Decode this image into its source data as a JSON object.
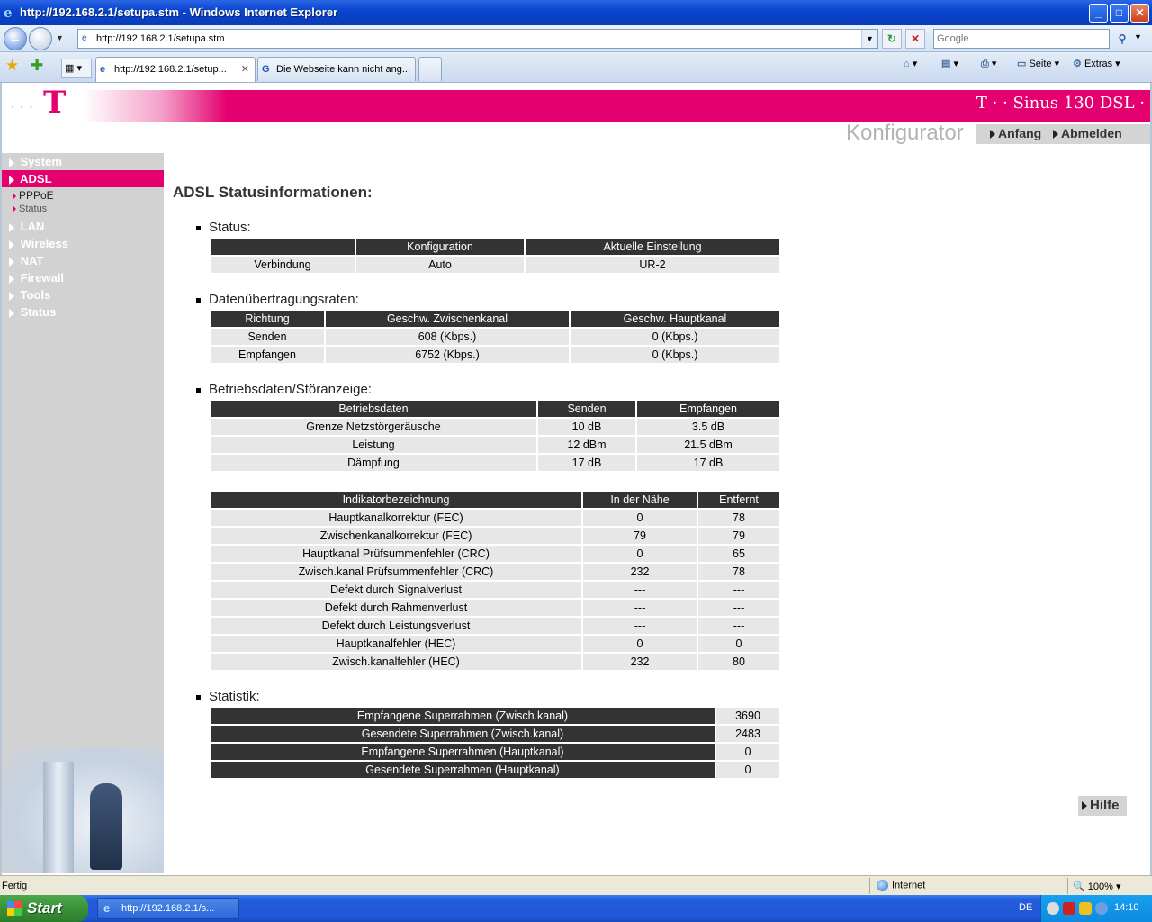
{
  "window": {
    "title": "http://192.168.2.1/setupa.stm - Windows Internet Explorer",
    "minimize": "_",
    "maximize": "□",
    "close": "✕"
  },
  "navbar": {
    "back": "←",
    "forward": "→",
    "address": "http://192.168.2.1/setupa.stm",
    "refresh": "↻",
    "stop": "✕",
    "search_placeholder": "Google"
  },
  "tabs": [
    {
      "label": "http://192.168.2.1/setup..."
    },
    {
      "label": "Die Webseite kann nicht ang..."
    }
  ],
  "tools": {
    "page": "Seite",
    "extras": "Extras"
  },
  "brand": {
    "logo": "T",
    "product": "T · · Sinus 130 DSL ·",
    "konfigurator": "Konfigurator"
  },
  "topnav": {
    "anfang": "Anfang",
    "abmelden": "Abmelden"
  },
  "sidebar": {
    "items": [
      "System",
      "ADSL",
      "LAN",
      "Wireless",
      "NAT",
      "Firewall",
      "Tools",
      "Status"
    ],
    "active": "ADSL",
    "subitems": [
      "PPPoE",
      "Status"
    ]
  },
  "main": {
    "title": "ADSL Statusinformationen:",
    "status": {
      "heading": "Status:",
      "headers": [
        "",
        "Konfiguration",
        "Aktuelle Einstellung"
      ],
      "rows": [
        [
          "Verbindung",
          "Auto",
          "UR-2"
        ]
      ]
    },
    "rates": {
      "heading": "Datenübertragungsraten:",
      "headers": [
        "Richtung",
        "Geschw. Zwischenkanal",
        "Geschw. Hauptkanal"
      ],
      "rows": [
        [
          "Senden",
          "608 (Kbps.)",
          "0 (Kbps.)"
        ],
        [
          "Empfangen",
          "6752 (Kbps.)",
          "0 (Kbps.)"
        ]
      ]
    },
    "operating": {
      "heading": "Betriebsdaten/Störanzeige:",
      "headers": [
        "Betriebsdaten",
        "Senden",
        "Empfangen"
      ],
      "rows": [
        [
          "Grenze Netzstörgeräusche",
          "10 dB",
          "3.5 dB"
        ],
        [
          "Leistung",
          "12 dBm",
          "21.5 dBm"
        ],
        [
          "Dämpfung",
          "17 dB",
          "17 dB"
        ]
      ]
    },
    "indicators": {
      "headers": [
        "Indikatorbezeichnung",
        "In der Nähe",
        "Entfernt"
      ],
      "rows": [
        [
          "Hauptkanalkorrektur (FEC)",
          "0",
          "78"
        ],
        [
          "Zwischenkanalkorrektur (FEC)",
          "79",
          "79"
        ],
        [
          "Hauptkanal Prüfsummenfehler (CRC)",
          "0",
          "65"
        ],
        [
          "Zwisch.kanal Prüfsummenfehler (CRC)",
          "232",
          "78"
        ],
        [
          "Defekt durch Signalverlust",
          "---",
          "---"
        ],
        [
          "Defekt durch Rahmenverlust",
          "---",
          "---"
        ],
        [
          "Defekt durch Leistungsverlust",
          "---",
          "---"
        ],
        [
          "Hauptkanalfehler (HEC)",
          "0",
          "0"
        ],
        [
          "Zwisch.kanalfehler (HEC)",
          "232",
          "80"
        ]
      ]
    },
    "statistics": {
      "heading": "Statistik:",
      "rows": [
        [
          "Empfangene Superrahmen (Zwisch.kanal)",
          "3690"
        ],
        [
          "Gesendete Superrahmen (Zwisch.kanal)",
          "2483"
        ],
        [
          "Empfangene Superrahmen (Hauptkanal)",
          "0"
        ],
        [
          "Gesendete Superrahmen (Hauptkanal)",
          "0"
        ]
      ]
    },
    "help": "Hilfe"
  },
  "statusbar": {
    "text": "Fertig",
    "zone": "Internet",
    "zoom": "100%"
  },
  "taskbar": {
    "start": "Start",
    "item": "http://192.168.2.1/s...",
    "lang": "DE",
    "clock": "14:10"
  },
  "colors": {
    "brand_magenta": "#e4006f",
    "table_header": "#333333",
    "table_cell": "#e7e7e7",
    "sidebar": "#d2d2d2"
  }
}
